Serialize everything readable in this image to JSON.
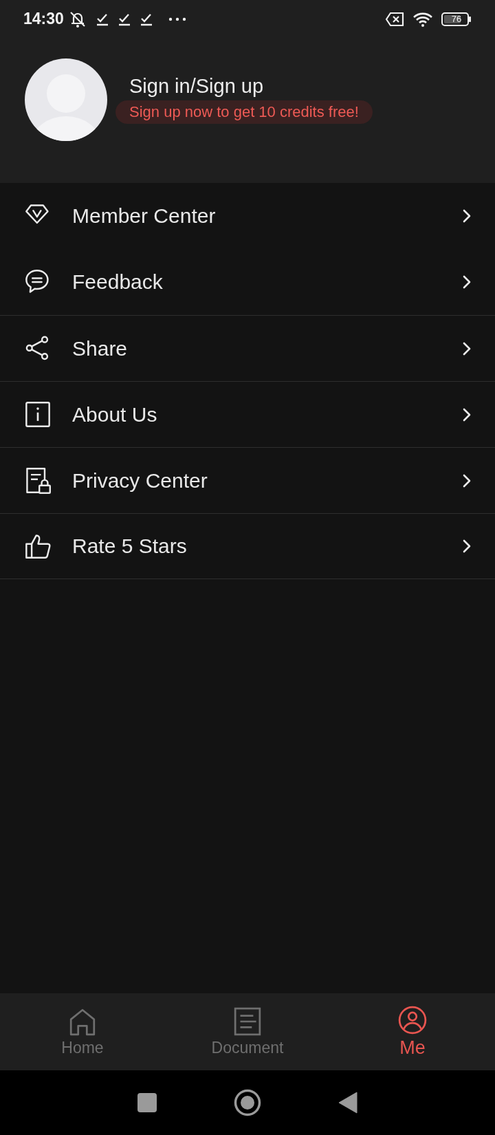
{
  "status_bar": {
    "time": "14:30",
    "battery": "76"
  },
  "profile": {
    "title": "Sign in/Sign up",
    "promo": "Sign up now to get 10 credits free!"
  },
  "menu": [
    {
      "label": "Member Center"
    },
    {
      "label": "Feedback"
    },
    {
      "label": "Share"
    },
    {
      "label": "About Us"
    },
    {
      "label": "Privacy Center"
    },
    {
      "label": "Rate 5 Stars"
    }
  ],
  "bottom_nav": [
    {
      "label": "Home",
      "selected": false
    },
    {
      "label": "Document",
      "selected": false
    },
    {
      "label": "Me",
      "selected": true
    }
  ]
}
